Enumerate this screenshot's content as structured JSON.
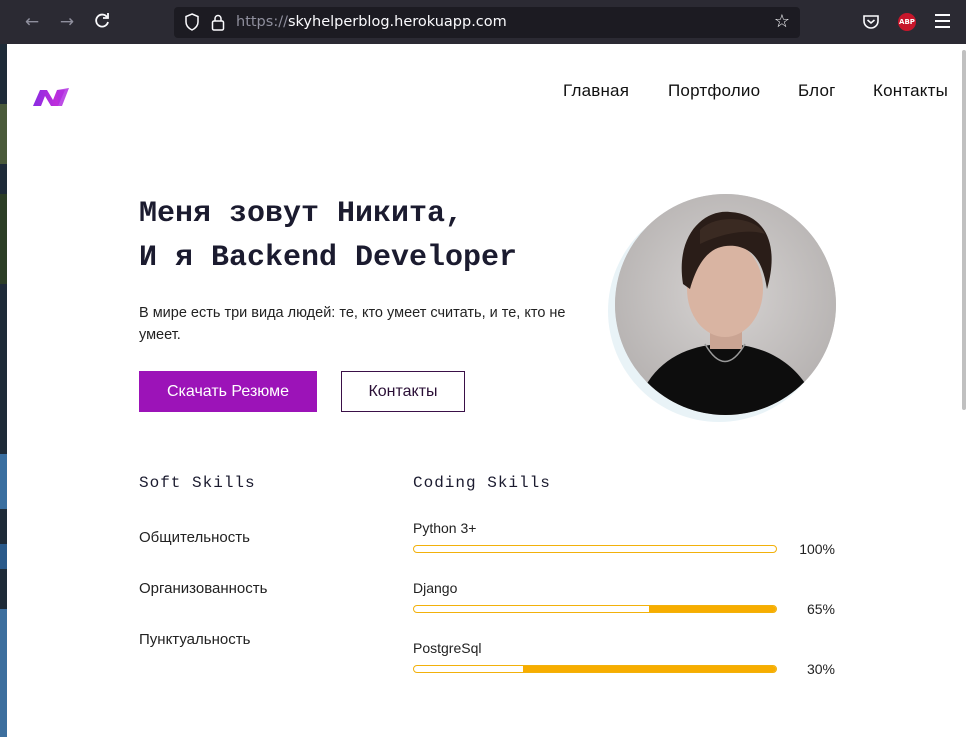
{
  "browser": {
    "url_protocol": "https://",
    "url_host": "skyhelperblog.herokuapp.com",
    "back_icon": "back-arrow-icon",
    "forward_icon": "forward-arrow-icon",
    "reload_icon": "reload-icon",
    "abp_label": "ABP"
  },
  "nav": {
    "items": [
      {
        "label": "Главная"
      },
      {
        "label": "Портфолио"
      },
      {
        "label": "Блог"
      },
      {
        "label": "Контакты"
      }
    ]
  },
  "hero": {
    "title_line1": "Меня зовут Никита,",
    "title_line2": "И я Backend Developer",
    "subtitle": "В мире есть три вида людей: те, кто умеет считать, и те, кто не умеет.",
    "cta_primary": "Скачать Резюме",
    "cta_secondary": "Контакты"
  },
  "soft_skills": {
    "title": "Soft Skills",
    "items": [
      "Общительность",
      "Организованность",
      "Пунктуальность"
    ]
  },
  "coding_skills": {
    "title": "Coding Skills",
    "items": [
      {
        "name": "Python 3+",
        "percent_label": "100%",
        "value": 100
      },
      {
        "name": "Django",
        "percent_label": "65%",
        "value": 65
      },
      {
        "name": "PostgreSql",
        "percent_label": "30%",
        "value": 30
      }
    ]
  },
  "colors": {
    "accent": "#9c13b8",
    "bar": "#f7ad00",
    "heading": "#1b1b2f"
  }
}
